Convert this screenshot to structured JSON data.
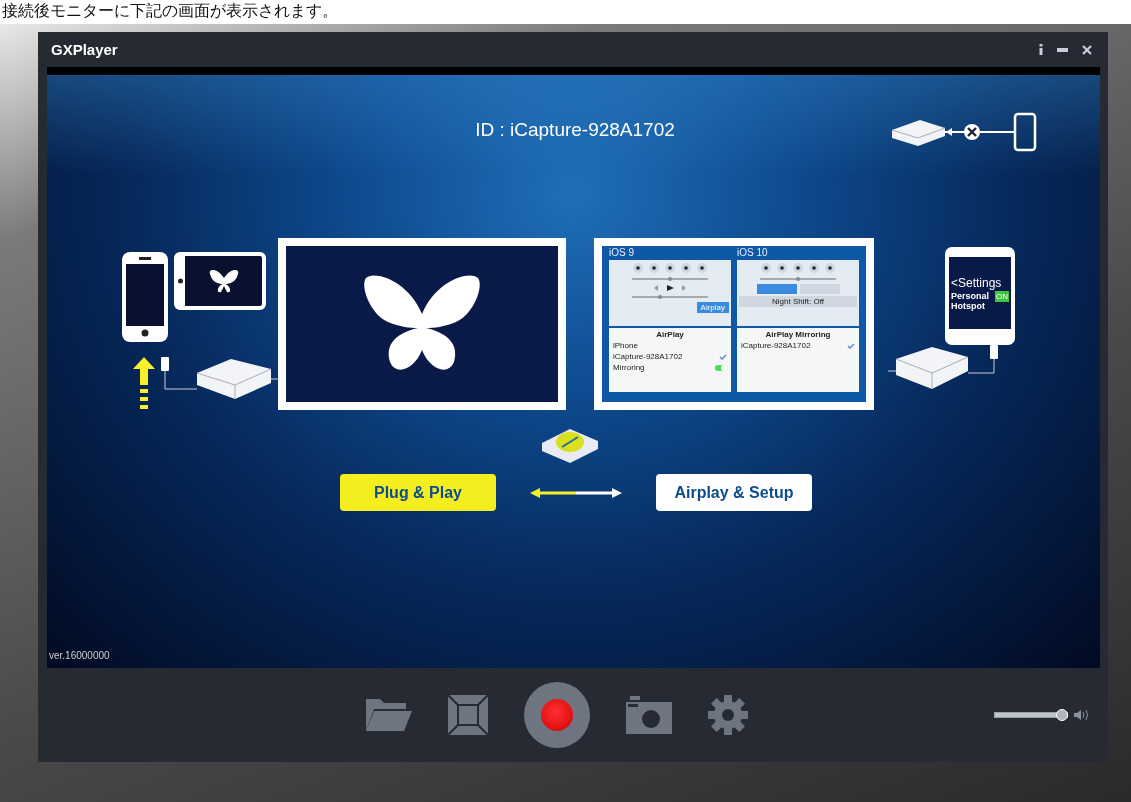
{
  "caption": "接続後モニターに下記の画面が表示されます。",
  "window": {
    "title": "GXPlayer"
  },
  "screen": {
    "device_id": "ID : iCapture-928A1702",
    "mirror_panels": [
      {
        "kind": "ios9",
        "version": "iOS 9",
        "control_button": "Airplay",
        "dialog_title": "AirPlay",
        "source": "iPhone",
        "device": "iCapture-928A1702",
        "checked": true,
        "option": "Mirroring",
        "option_on": true
      },
      {
        "kind": "ios10",
        "version": "iOS 10",
        "control_button": "Night Shift: Off",
        "dialog_title": "AirPlay Mirroring",
        "device": "iCapture-928A1702",
        "checked": true
      }
    ],
    "hotspot": {
      "back": "<Settings",
      "label": "Personal Hotspot",
      "toggle": "ON",
      "on": true
    },
    "modes": [
      {
        "label": "Plug & Play",
        "selected": true
      },
      {
        "label": "Airplay & Setup",
        "selected": false
      }
    ],
    "version": "ver.16000000"
  },
  "volume": {
    "level": 0.93
  }
}
